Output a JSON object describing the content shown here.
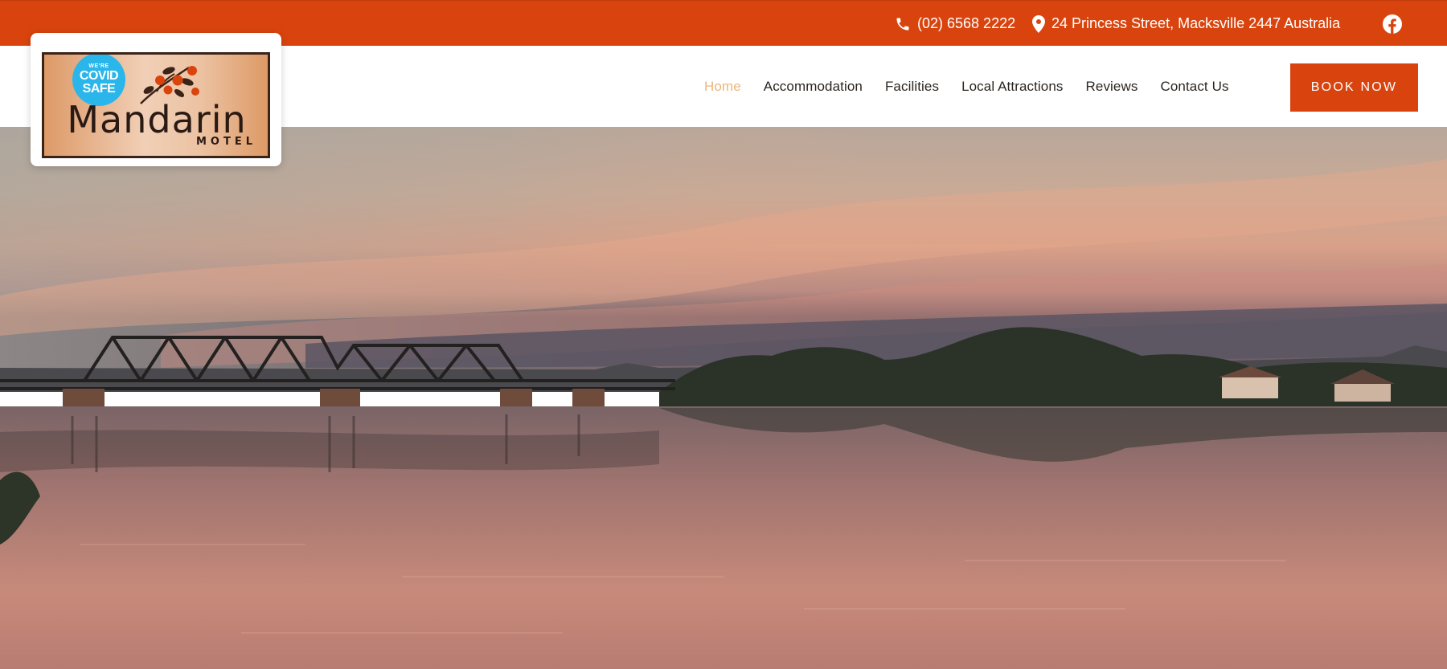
{
  "topbar": {
    "phone": "(02) 6568 2222",
    "address": "24 Princess Street, Macksville 2447 Australia",
    "phone_icon": "phone-icon",
    "location_icon": "map-pin-icon",
    "social_icon": "facebook-icon"
  },
  "logo": {
    "badge_small": "WE'RE",
    "badge_line1": "COVID",
    "badge_line2": "SAFE",
    "name": "Mandarin",
    "subtitle": "MOTEL"
  },
  "nav": {
    "items": [
      {
        "label": "Home",
        "active": true
      },
      {
        "label": "Accommodation",
        "active": false
      },
      {
        "label": "Facilities",
        "active": false
      },
      {
        "label": "Local Attractions",
        "active": false
      },
      {
        "label": "Reviews",
        "active": false
      },
      {
        "label": "Contact Us",
        "active": false
      }
    ],
    "book_label": "BOOK NOW"
  },
  "colors": {
    "brand_orange": "#d9440e",
    "active_nav": "#e9b77d",
    "nav_text": "#2b2622",
    "covid_blue": "#2ab6ea"
  }
}
